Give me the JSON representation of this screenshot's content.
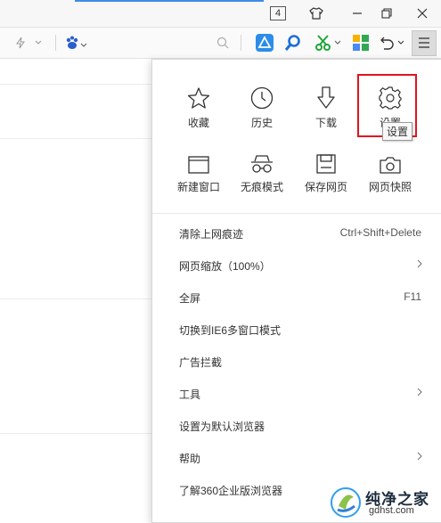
{
  "titlebar": {
    "tab_count": "4"
  },
  "menu": {
    "top_grid": [
      {
        "label": "收藏",
        "icon": "star-icon"
      },
      {
        "label": "历史",
        "icon": "clock-icon"
      },
      {
        "label": "下载",
        "icon": "download-arrow-icon"
      },
      {
        "label": "设置",
        "icon": "gear-icon"
      },
      {
        "label": "新建窗口",
        "icon": "window-icon"
      },
      {
        "label": "无痕模式",
        "icon": "incognito-glasses-icon"
      },
      {
        "label": "保存网页",
        "icon": "floppy-save-icon"
      },
      {
        "label": "网页快照",
        "icon": "camera-icon"
      }
    ],
    "tooltip": "设置",
    "items": [
      {
        "label": "清除上网痕迹",
        "shortcut": "Ctrl+Shift+Delete"
      },
      {
        "label": "网页缩放（100%）",
        "submenu": true
      },
      {
        "label": "全屏",
        "shortcut": "F11"
      },
      {
        "label": "切换到IE6多窗口模式"
      },
      {
        "label": "广告拦截"
      },
      {
        "label": "工具",
        "submenu": true
      },
      {
        "label": "设置为默认浏览器"
      },
      {
        "label": "帮助",
        "submenu": true
      },
      {
        "label": "了解360企业版浏览器"
      }
    ]
  },
  "watermark": {
    "title": "纯净之家",
    "url": "gdhst.com"
  },
  "colors": {
    "highlight_border": "#e0141e",
    "tab_accent": "#3d8de6"
  }
}
